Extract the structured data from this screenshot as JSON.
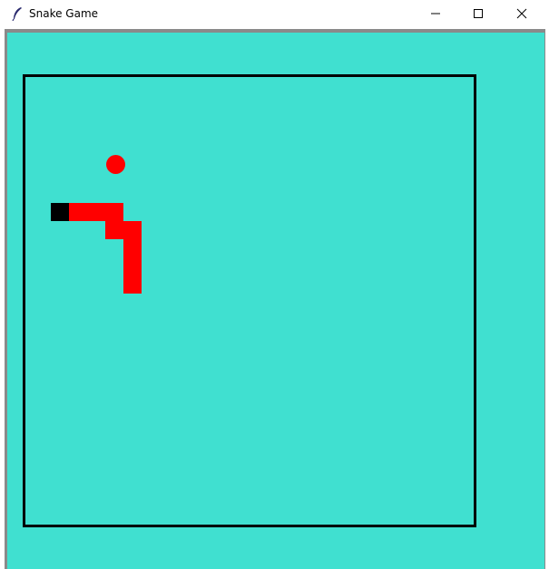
{
  "window": {
    "title": "Snake Game",
    "icon": "feather-icon",
    "controls": [
      "minimize-icon",
      "maximize-icon",
      "close-icon"
    ]
  },
  "colors": {
    "background": "#40e0d0",
    "snake_body": "#ff0000",
    "snake_head": "#000000",
    "food": "#ff0000",
    "border": "#000000"
  },
  "game": {
    "grid_cell": 20,
    "snake": [
      {
        "col": 0,
        "row": 0,
        "part": "head"
      },
      {
        "col": 1,
        "row": 0,
        "part": "body"
      },
      {
        "col": 2,
        "row": 0,
        "part": "body"
      },
      {
        "col": 3,
        "row": 0,
        "part": "body"
      },
      {
        "col": 3,
        "row": 1,
        "part": "body"
      },
      {
        "col": 4,
        "row": 1,
        "part": "body"
      },
      {
        "col": 4,
        "row": 2,
        "part": "body"
      },
      {
        "col": 4,
        "row": 3,
        "part": "body"
      },
      {
        "col": 4,
        "row": 4,
        "part": "body"
      }
    ]
  }
}
